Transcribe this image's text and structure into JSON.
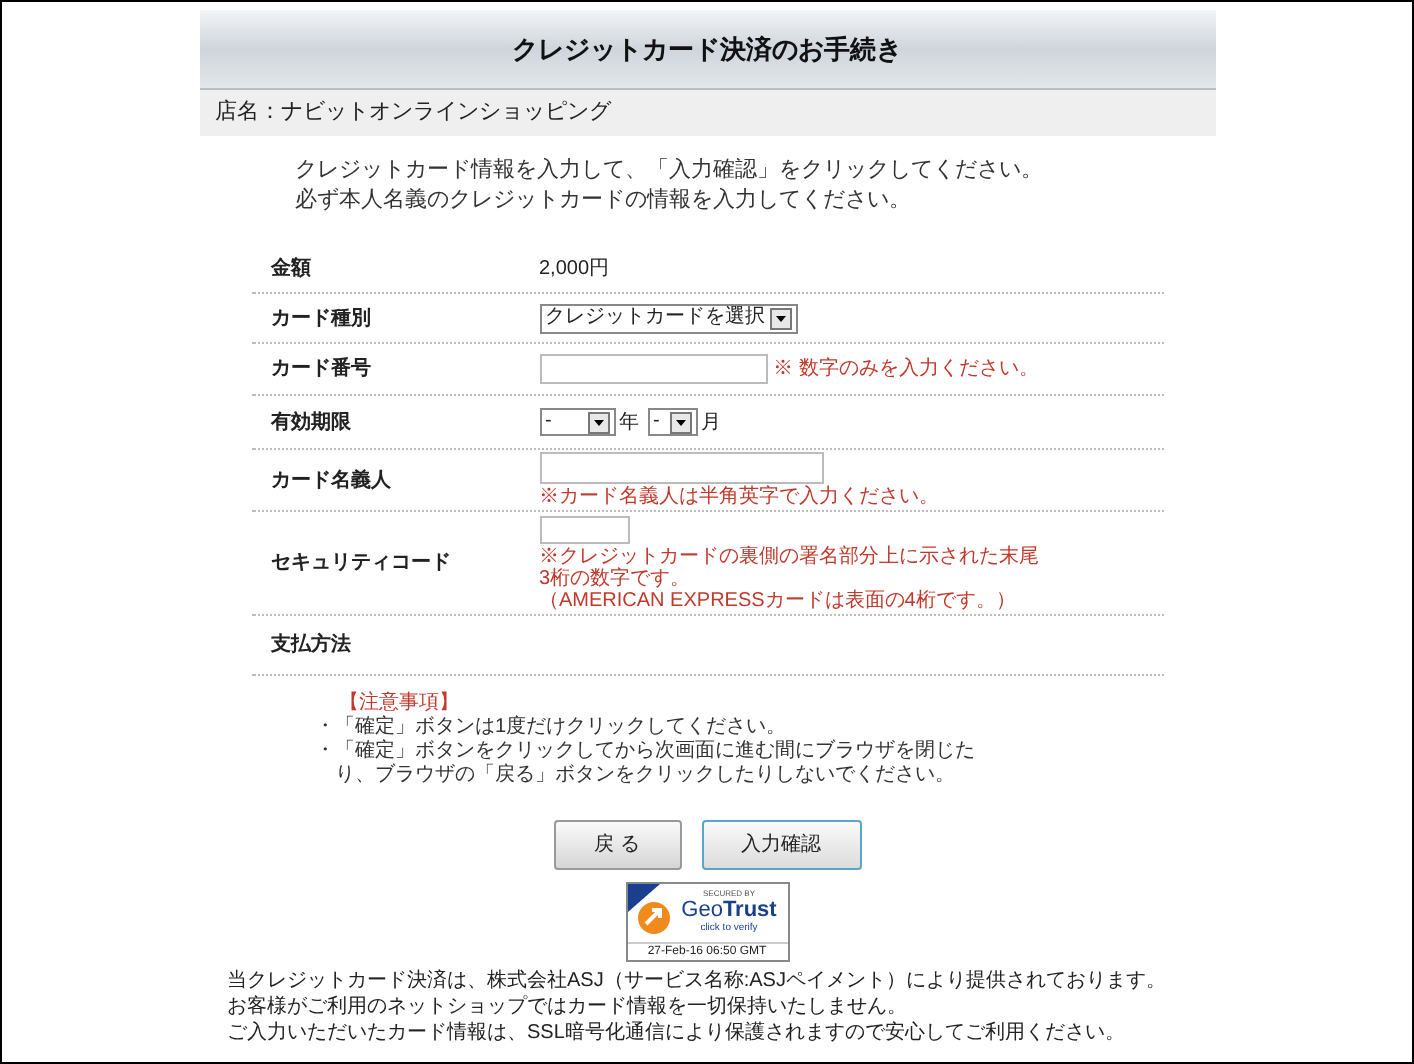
{
  "header": {
    "title": "クレジットカード決済のお手続き"
  },
  "shop": {
    "label": "店名：ナビットオンラインショッピング"
  },
  "intro": [
    "クレジットカード情報を入力して、「入力確認」をクリックしてください。",
    "必ず本人名義のクレジットカードの情報を入力してください。"
  ],
  "rows": [
    {
      "label": "金額",
      "kind": "text",
      "value": "2,000円"
    },
    {
      "label": "カード種別",
      "kind": "select",
      "value": "クレジットカードを選択"
    },
    {
      "label": "カード番号",
      "kind": "input_inline",
      "notes": [
        "※ 数字のみを入力ください。"
      ]
    },
    {
      "label": "有効期限",
      "kind": "expiry",
      "year": "-",
      "year_unit": "年",
      "month": "-",
      "month_unit": "月"
    },
    {
      "label": "カード名義人",
      "kind": "input_below",
      "notes": [
        "※カード名義人は半角英字で入力ください。"
      ]
    },
    {
      "label": "セキュリティコード",
      "kind": "input_small",
      "notes": [
        "※クレジットカードの裏側の署名部分上に示された末尾",
        "3桁の数字です。",
        "（AMERICAN EXPRESSカードは表面の4桁です。）"
      ]
    },
    {
      "label": "支払方法",
      "kind": "empty"
    }
  ],
  "notice": {
    "title": "【注意事項】",
    "items": [
      {
        "bullet": "・",
        "text": "「確定」ボタンは1度だけクリックしてください。"
      },
      {
        "bullet": "・",
        "text": "「確定」ボタンをクリックしてから次画面に進む間にブラウザを閉じたり、ブラウザの「戻る」ボタンをクリックしたりしないでください。"
      }
    ]
  },
  "buttons": [
    {
      "label": "戻 る",
      "kind": "back"
    },
    {
      "label": "入力確認",
      "kind": "primary"
    }
  ],
  "seal": {
    "secured_by": "SECURED BY",
    "brand": "Geo**Trust**",
    "action": "click to verify",
    "date": "27-Feb-16 06:50 GMT"
  },
  "footer": [
    "当クレジットカード決済は、株式会社ASJ（サービス名称:ASJペイメント）により提供されております。",
    "お客様がご利用のネットショップではカード情報を一切保持いたしません。",
    "ご入力いただいたカード情報は、SSL暗号化通信により保護されますので安心してご利用ください。"
  ]
}
